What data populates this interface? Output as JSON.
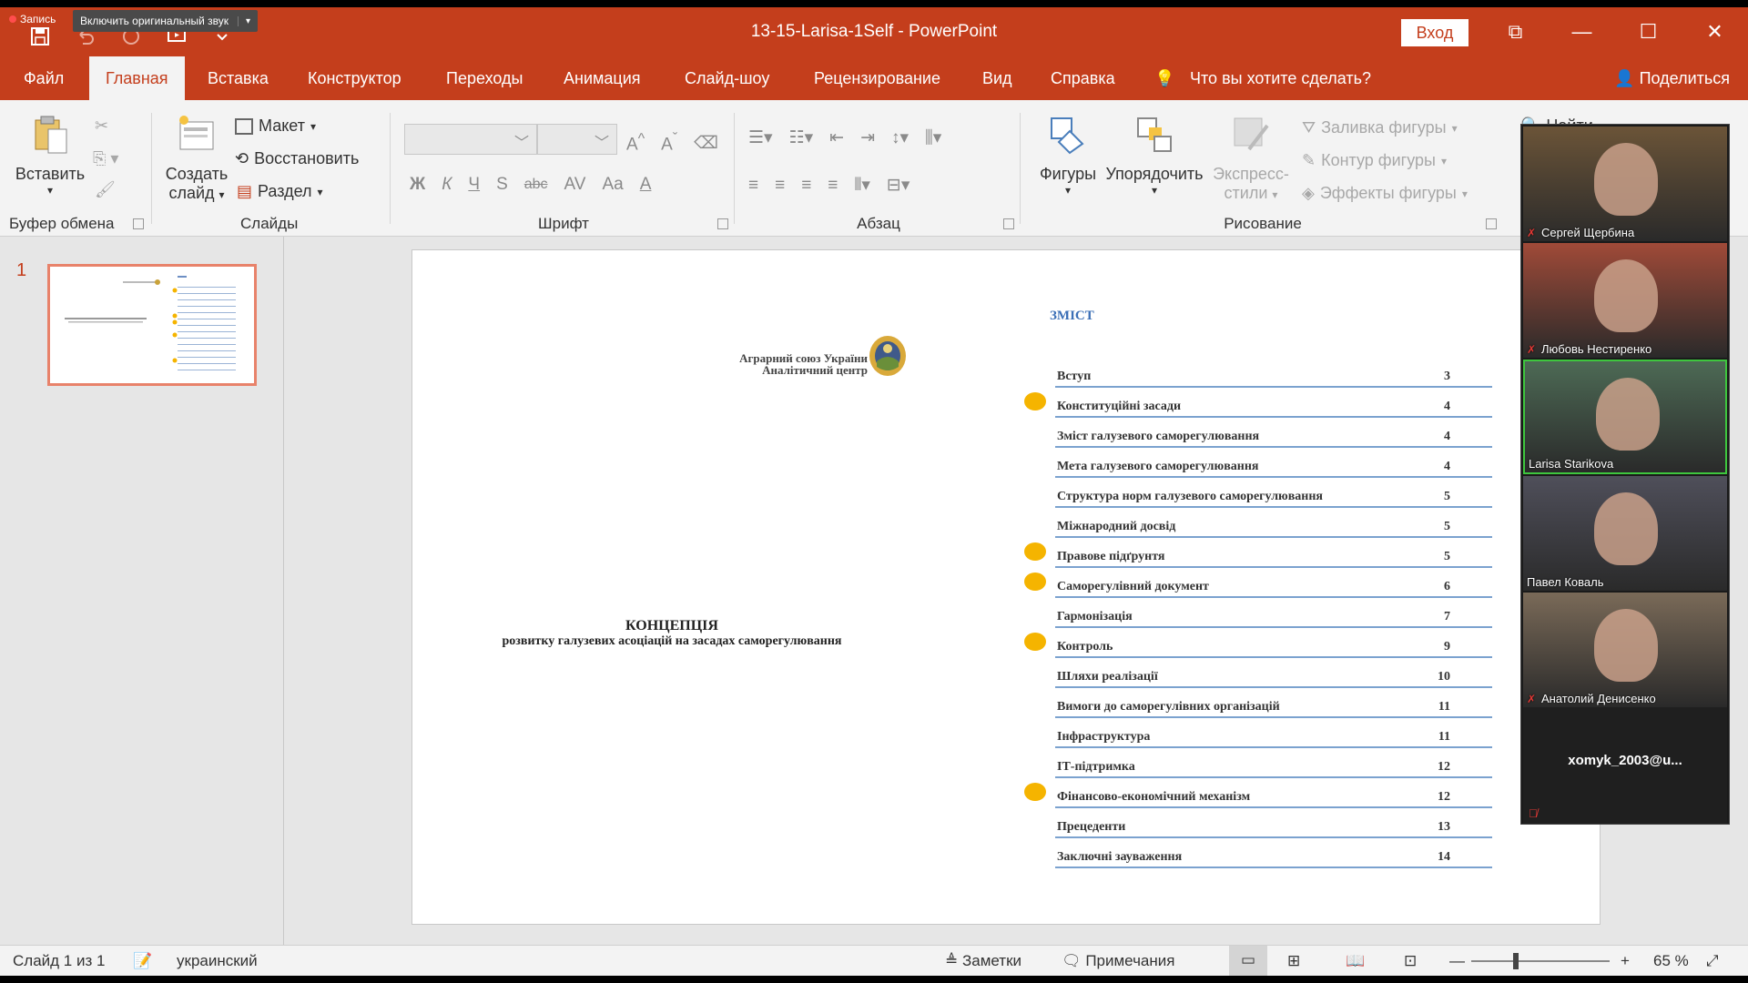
{
  "zoom_overlay": {
    "recording": "Запись",
    "audio_button": "Включить оригинальный звук"
  },
  "window": {
    "title": "13-15-Larisa-1Self  -  PowerPoint",
    "signin": "Вход"
  },
  "tabs": [
    "Файл",
    "Главная",
    "Вставка",
    "Конструктор",
    "Переходы",
    "Анимация",
    "Слайд-шоу",
    "Рецензирование",
    "Вид",
    "Справка"
  ],
  "tell_me": "Что вы хотите сделать?",
  "share": "Поделиться",
  "ribbon": {
    "clipboard": {
      "paste": "Вставить",
      "label": "Буфер обмена"
    },
    "slides": {
      "new_slide_line1": "Создать",
      "new_slide_line2": "слайд",
      "layout": "Макет",
      "reset": "Восстановить",
      "section": "Раздел",
      "label": "Слайды"
    },
    "font": {
      "label": "Шрифт",
      "bold": "Ж",
      "italic": "К",
      "underline": "Ч",
      "shadow": "S",
      "strike": "abc",
      "spacing": "AV",
      "case": "Aa",
      "color": "A"
    },
    "paragraph": {
      "label": "Абзац"
    },
    "drawing": {
      "shapes": "Фигуры",
      "arrange": "Упорядочить",
      "quick_styles_line1": "Экспресс-",
      "quick_styles_line2": "стили",
      "fill": "Заливка фигуры",
      "outline": "Контур фигуры",
      "effects": "Эффекты фигуры",
      "label": "Рисование"
    },
    "find": "Найти"
  },
  "thumbnail": {
    "number": "1"
  },
  "slide": {
    "org_line1": "Аграрний союз України",
    "org_line2": "Аналітичний центр",
    "concept_title": "КОНЦЕПЦІЯ",
    "concept_subtitle": "розвитку галузевих асоціацій на засадах саморегулювання",
    "toc_heading": "ЗМІСТ",
    "toc": [
      {
        "label": "Вступ",
        "page": "3",
        "marked": false
      },
      {
        "label": "Конституційні засади",
        "page": "4",
        "marked": true
      },
      {
        "label": "Зміст галузевого саморегулювання",
        "page": "4",
        "marked": false
      },
      {
        "label": "Мета галузевого саморегулювання",
        "page": "4",
        "marked": false
      },
      {
        "label": "Структура норм галузевого саморегулювання",
        "page": "5",
        "marked": false
      },
      {
        "label": "Міжнародний досвід",
        "page": "5",
        "marked": false
      },
      {
        "label": "Правове підґрунтя",
        "page": "5",
        "marked": true
      },
      {
        "label": "Саморегулівний документ",
        "page": "6",
        "marked": true
      },
      {
        "label": "Гармонізація",
        "page": "7",
        "marked": false
      },
      {
        "label": "Контроль",
        "page": "9",
        "marked": true
      },
      {
        "label": "Шляхи реалізації",
        "page": "10",
        "marked": false
      },
      {
        "label": "Вимоги до саморегулівних організацій",
        "page": "11",
        "marked": false
      },
      {
        "label": "Інфраструктура",
        "page": "11",
        "marked": false
      },
      {
        "label": "ІТ-підтримка",
        "page": "12",
        "marked": false
      },
      {
        "label": "Фінансово-економічний механізм",
        "page": "12",
        "marked": true
      },
      {
        "label": "Прецеденти",
        "page": "13",
        "marked": false
      },
      {
        "label": "Заключні зауваження",
        "page": "14",
        "marked": false
      }
    ]
  },
  "participants": [
    {
      "name": "Сергей Щербина",
      "muted": true,
      "bg": "#6b5438"
    },
    {
      "name": "Любовь Нестиренко",
      "muted": true,
      "bg": "#a04a38"
    },
    {
      "name": "Larisa Starikova",
      "muted": false,
      "bg": "#4d6a55"
    },
    {
      "name": "Павел Коваль",
      "muted": false,
      "bg": "#4f4f5a"
    },
    {
      "name": "Анатолий Денисенко",
      "muted": true,
      "bg": "#7a6a58"
    }
  ],
  "participant_extra": "xomyk_2003@u...",
  "status": {
    "slide": "Слайд 1 из 1",
    "language": "украинский",
    "notes": "Заметки",
    "comments": "Примечания",
    "zoom": "65 %"
  }
}
